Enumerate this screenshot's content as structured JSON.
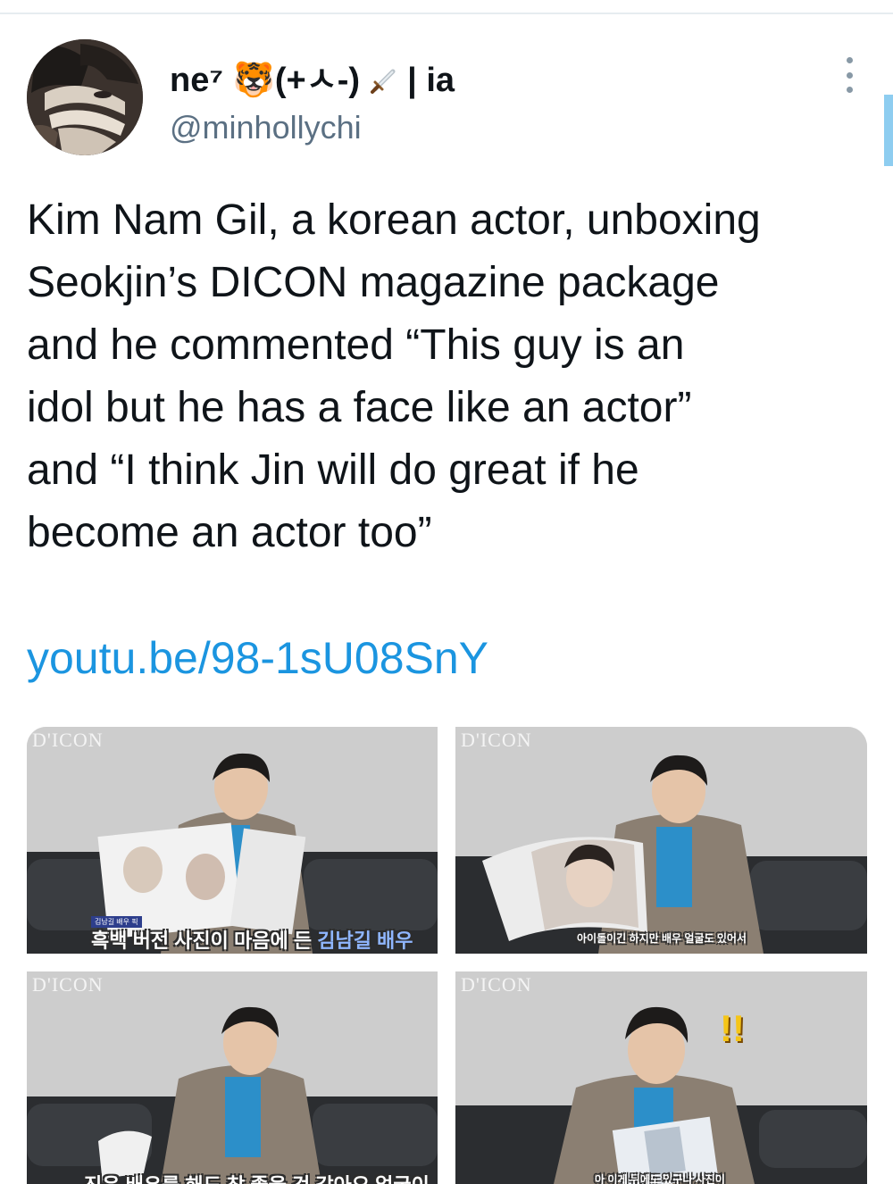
{
  "tweet": {
    "display_name": "ne⁷ 🐯(+ㅅ-)",
    "display_name_suffix": "| ia",
    "handle": "@minhollychi",
    "text_lines": [
      "Kim Nam Gil, a korean actor, unboxing",
      "Seokjin’s DICON magazine package",
      "and he commented “This guy is an",
      "idol but he has a face like an actor”",
      "and “I think Jin will do great if he",
      "become an actor too”"
    ],
    "link": "youtu.be/98-1sU08SnY"
  },
  "icons": {
    "dagger": "dagger-icon",
    "more": "more-options-icon"
  },
  "colors": {
    "link": "#1b95e0",
    "handle": "#5b7083",
    "subtitle_highlight": "#8fb6ff",
    "exclaim": "#f5c518"
  },
  "media": [
    {
      "watermark": "D'ICON",
      "subtitle_tag": "김남길 배우 픽",
      "subtitle": "흑백 버전 사진이 마음에 든",
      "subtitle_highlight": "김남길 배우"
    },
    {
      "watermark": "D'ICON",
      "subtitle": "아이돌이긴 하지만 배우 얼굴도 있어서"
    },
    {
      "watermark": "D'ICON",
      "subtitle": "진은 배우를 해도 참 좋을 것 같아요 얼굴이"
    },
    {
      "watermark": "D'ICON",
      "exclaim": "!!",
      "subtitle": "아 이게 뒤에도 있구나 사진이"
    }
  ]
}
